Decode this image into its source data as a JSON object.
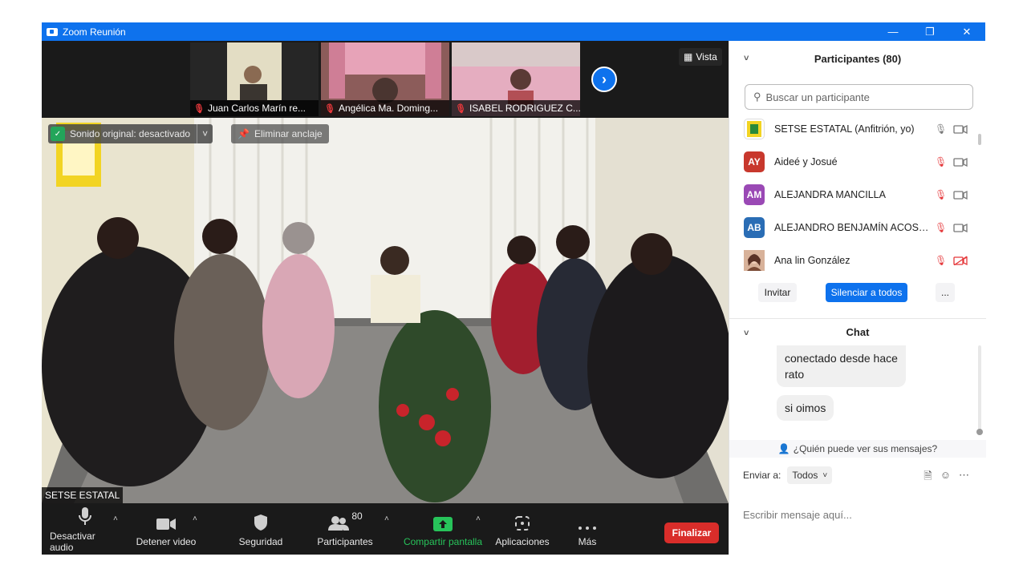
{
  "window": {
    "title": "Zoom Reunión"
  },
  "thumbnails": [
    {
      "name": "Juan Carlos Marín re..."
    },
    {
      "name": "Angélica Ma. Doming..."
    },
    {
      "name": "ISABEL RODRIGUEZ C..."
    }
  ],
  "view_label": "Vista",
  "main_video": {
    "sound_label": "Sonido original: desactivado",
    "unpin_label": "Eliminar anclaje",
    "speaker_name": "SETSE ESTATAL"
  },
  "toolbar": {
    "audio": "Desactivar audio",
    "video": "Detener video",
    "security": "Seguridad",
    "participants": "Participantes",
    "participant_count": "80",
    "share": "Compartir pantalla",
    "apps": "Aplicaciones",
    "more": "Más",
    "end": "Finalizar"
  },
  "participants_panel": {
    "title": "Participantes (80)",
    "search_placeholder": "Buscar un participante",
    "list": [
      {
        "initials": "",
        "name": "SETSE ESTATAL (Anfitrión, yo)",
        "avatar_color": "#ffffff",
        "mic": "on",
        "cam": "on"
      },
      {
        "initials": "AY",
        "name": "Aideé y Josué",
        "avatar_color": "#c8382d",
        "mic": "muted",
        "cam": "on"
      },
      {
        "initials": "AM",
        "name": "ALEJANDRA MANCILLA",
        "avatar_color": "#9a49b5",
        "mic": "muted",
        "cam": "on"
      },
      {
        "initials": "AB",
        "name": "ALEJANDRO BENJAMÍN ACOST...",
        "avatar_color": "#2a6db5",
        "mic": "muted",
        "cam": "on"
      },
      {
        "initials": "",
        "name": "Ana lin González",
        "avatar_color": "#b07a60",
        "mic": "muted",
        "cam": "off"
      }
    ],
    "invite": "Invitar",
    "mute_all": "Silenciar a todos",
    "more": "..."
  },
  "chat": {
    "title": "Chat",
    "messages": [
      {
        "text_line1": "conectado desde hace",
        "text_line2": "rato"
      },
      {
        "text_line1": "si oimos"
      }
    ],
    "who_sees": "¿Quién puede ver sus mensajes?",
    "send_to_label": "Enviar a:",
    "send_to_value": "Todos",
    "input_placeholder": "Escribir mensaje aquí..."
  }
}
